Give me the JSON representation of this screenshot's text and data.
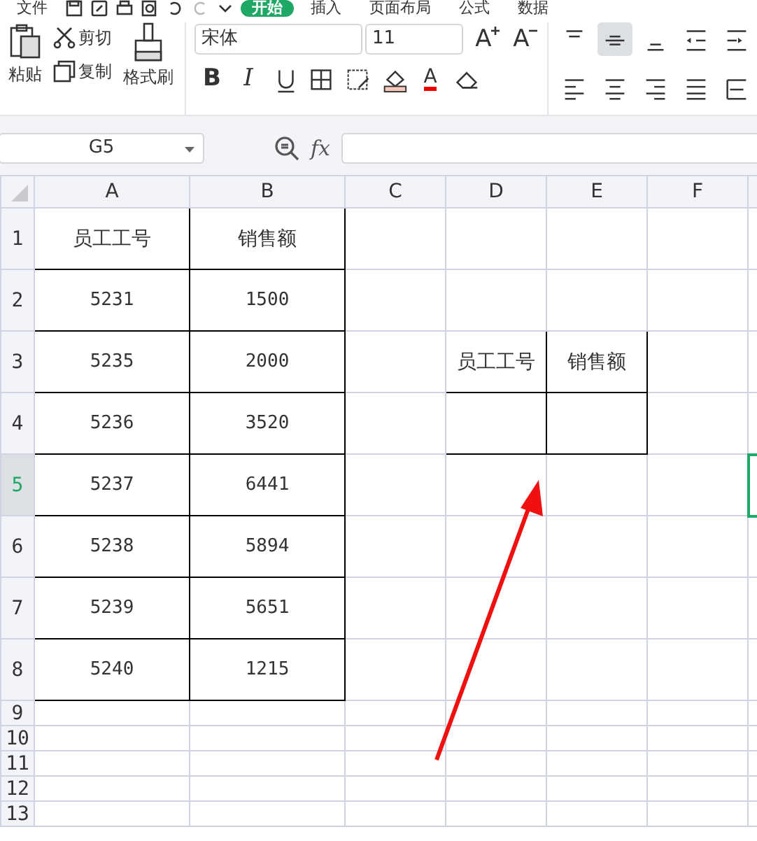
{
  "menu": [
    {
      "label": "文件",
      "selected": false
    },
    {
      "label": "开始",
      "selected": true
    },
    {
      "label": "插入",
      "selected": false
    },
    {
      "label": "页面布局",
      "selected": false
    },
    {
      "label": "公式",
      "selected": false
    },
    {
      "label": "数据",
      "selected": false
    }
  ],
  "quick_access": [
    {
      "kind": "save"
    },
    {
      "kind": "export"
    },
    {
      "kind": "print"
    },
    {
      "kind": "preview"
    },
    {
      "kind": "undo"
    },
    {
      "kind": "redo"
    },
    {
      "kind": "more"
    }
  ],
  "clipboard": {
    "paste": "粘贴",
    "cut": "剪切",
    "copy": "复制",
    "format_painter": "格式刷"
  },
  "font": {
    "name": "宋体",
    "size": "11"
  },
  "font_buttons": [
    {
      "kind": "grow",
      "glyph": "A"
    },
    {
      "kind": "shrink",
      "glyph": "A"
    },
    {
      "kind": "bold",
      "glyph": "B"
    },
    {
      "kind": "italic",
      "glyph": "I"
    },
    {
      "kind": "underline"
    },
    {
      "kind": "border"
    },
    {
      "kind": "cellstyle"
    },
    {
      "kind": "fill"
    },
    {
      "kind": "fontcolor",
      "glyph": "A"
    },
    {
      "kind": "eraser"
    }
  ],
  "function_label": "fx",
  "align_buttons": [
    {
      "kind": "top",
      "selected": false
    },
    {
      "kind": "middle",
      "selected": true
    },
    {
      "kind": "bottom",
      "selected": false
    },
    {
      "kind": "outdent",
      "selected": false
    },
    {
      "kind": "indent",
      "selected": false
    },
    {
      "kind": "left",
      "selected": false
    },
    {
      "kind": "center",
      "selected": false
    },
    {
      "kind": "right",
      "selected": false
    },
    {
      "kind": "justify",
      "selected": false
    },
    {
      "kind": "distribute",
      "selected": false
    }
  ],
  "name_box": "G5",
  "columns": [
    "A",
    "B",
    "C",
    "D",
    "E",
    "F"
  ],
  "rows": [
    {
      "number": "1",
      "selected": false,
      "cells": {
        "A": {
          "text": "员工工号",
          "bordered": true
        },
        "B": {
          "text": "销售额",
          "bordered": true
        }
      }
    },
    {
      "number": "2",
      "selected": false,
      "cells": {
        "A": {
          "text": "5231",
          "bordered": true
        },
        "B": {
          "text": "1500",
          "bordered": true
        }
      }
    },
    {
      "number": "3",
      "selected": false,
      "cells": {
        "A": {
          "text": "5235",
          "bordered": true
        },
        "B": {
          "text": "2000",
          "bordered": true
        },
        "D": {
          "text": "员工工号",
          "bordered": true
        },
        "E": {
          "text": "销售额",
          "bordered": true
        }
      }
    },
    {
      "number": "4",
      "selected": false,
      "cells": {
        "A": {
          "text": "5236",
          "bordered": true
        },
        "B": {
          "text": "3520",
          "bordered": true
        },
        "D": {
          "bordered": true
        },
        "E": {
          "bordered": true
        }
      }
    },
    {
      "number": "5",
      "selected": true,
      "cells": {
        "A": {
          "text": "5237",
          "bordered": true
        },
        "B": {
          "text": "6441",
          "bordered": true
        }
      }
    },
    {
      "number": "6",
      "selected": false,
      "cells": {
        "A": {
          "text": "5238",
          "bordered": true
        },
        "B": {
          "text": "5894",
          "bordered": true
        }
      }
    },
    {
      "number": "7",
      "selected": false,
      "cells": {
        "A": {
          "text": "5239",
          "bordered": true
        },
        "B": {
          "text": "5651",
          "bordered": true
        }
      }
    },
    {
      "number": "8",
      "selected": false,
      "cells": {
        "A": {
          "text": "5240",
          "bordered": true
        },
        "B": {
          "text": "1215",
          "bordered": true
        }
      }
    },
    {
      "number": "9",
      "selected": false,
      "cells": {}
    },
    {
      "number": "10",
      "selected": false,
      "cells": {}
    },
    {
      "number": "11",
      "selected": false,
      "cells": {}
    },
    {
      "number": "12",
      "selected": false,
      "cells": {}
    },
    {
      "number": "13",
      "selected": false,
      "cells": {}
    }
  ]
}
